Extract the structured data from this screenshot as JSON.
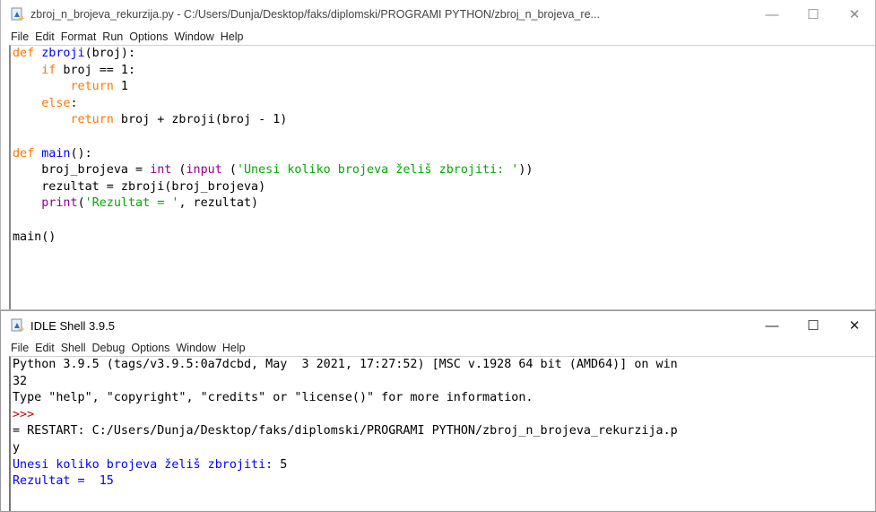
{
  "editor": {
    "title": "zbroj_n_brojeva_rekurzija.py - C:/Users/Dunja/Desktop/faks/diplomski/PROGRAMI PYTHON/zbroj_n_brojeva_re...",
    "menu": [
      "File",
      "Edit",
      "Format",
      "Run",
      "Options",
      "Window",
      "Help"
    ],
    "code": {
      "l1_kw": "def",
      "l1_fn": "zbroji",
      "l1_rest": "(broj):",
      "l2_ind": "    ",
      "l2_kw": "if",
      "l2_rest": " broj == 1:",
      "l3_ind": "        ",
      "l3_kw": "return",
      "l3_rest": " 1",
      "l4_ind": "    ",
      "l4_kw": "else",
      "l4_rest": ":",
      "l5_ind": "        ",
      "l5_kw": "return",
      "l5_rest": " broj + zbroji(broj - 1)",
      "l7_kw": "def",
      "l7_fn": "main",
      "l7_rest": "():",
      "l8_a": "    broj_brojeva = ",
      "l8_bi1": "int",
      "l8_b": " (",
      "l8_bi2": "input",
      "l8_c": " (",
      "l8_st": "'Unesi koliko brojeva želiš zbrojiti: '",
      "l8_d": "))",
      "l9": "    rezultat = zbroji(broj_brojeva)",
      "l10_ind": "    ",
      "l10_bi": "print",
      "l10_a": "(",
      "l10_st": "'Rezultat = '",
      "l10_b": ", rezultat)",
      "l12": "main()"
    }
  },
  "shell": {
    "title": "IDLE Shell 3.9.5",
    "menu": [
      "File",
      "Edit",
      "Shell",
      "Debug",
      "Options",
      "Window",
      "Help"
    ],
    "lines": {
      "banner1": "Python 3.9.5 (tags/v3.9.5:0a7dcbd, May  3 2021, 17:27:52) [MSC v.1928 64 bit (AMD64)] on win",
      "banner2": "32",
      "banner3": "Type \"help\", \"copyright\", \"credits\" or \"license()\" for more information.",
      "prompt": ">>>",
      "restart1": "= RESTART: C:/Users/Dunja/Desktop/faks/diplomski/PROGRAMI PYTHON/zbroj_n_brojeva_rekurzija.p",
      "restart2": "y",
      "out1": "Unesi koliko brojeva želiš zbrojiti: ",
      "input1": "5",
      "out2": "Rezultat =  15"
    }
  },
  "controls": {
    "minimize": "—",
    "maximize": "☐",
    "close": "✕"
  }
}
